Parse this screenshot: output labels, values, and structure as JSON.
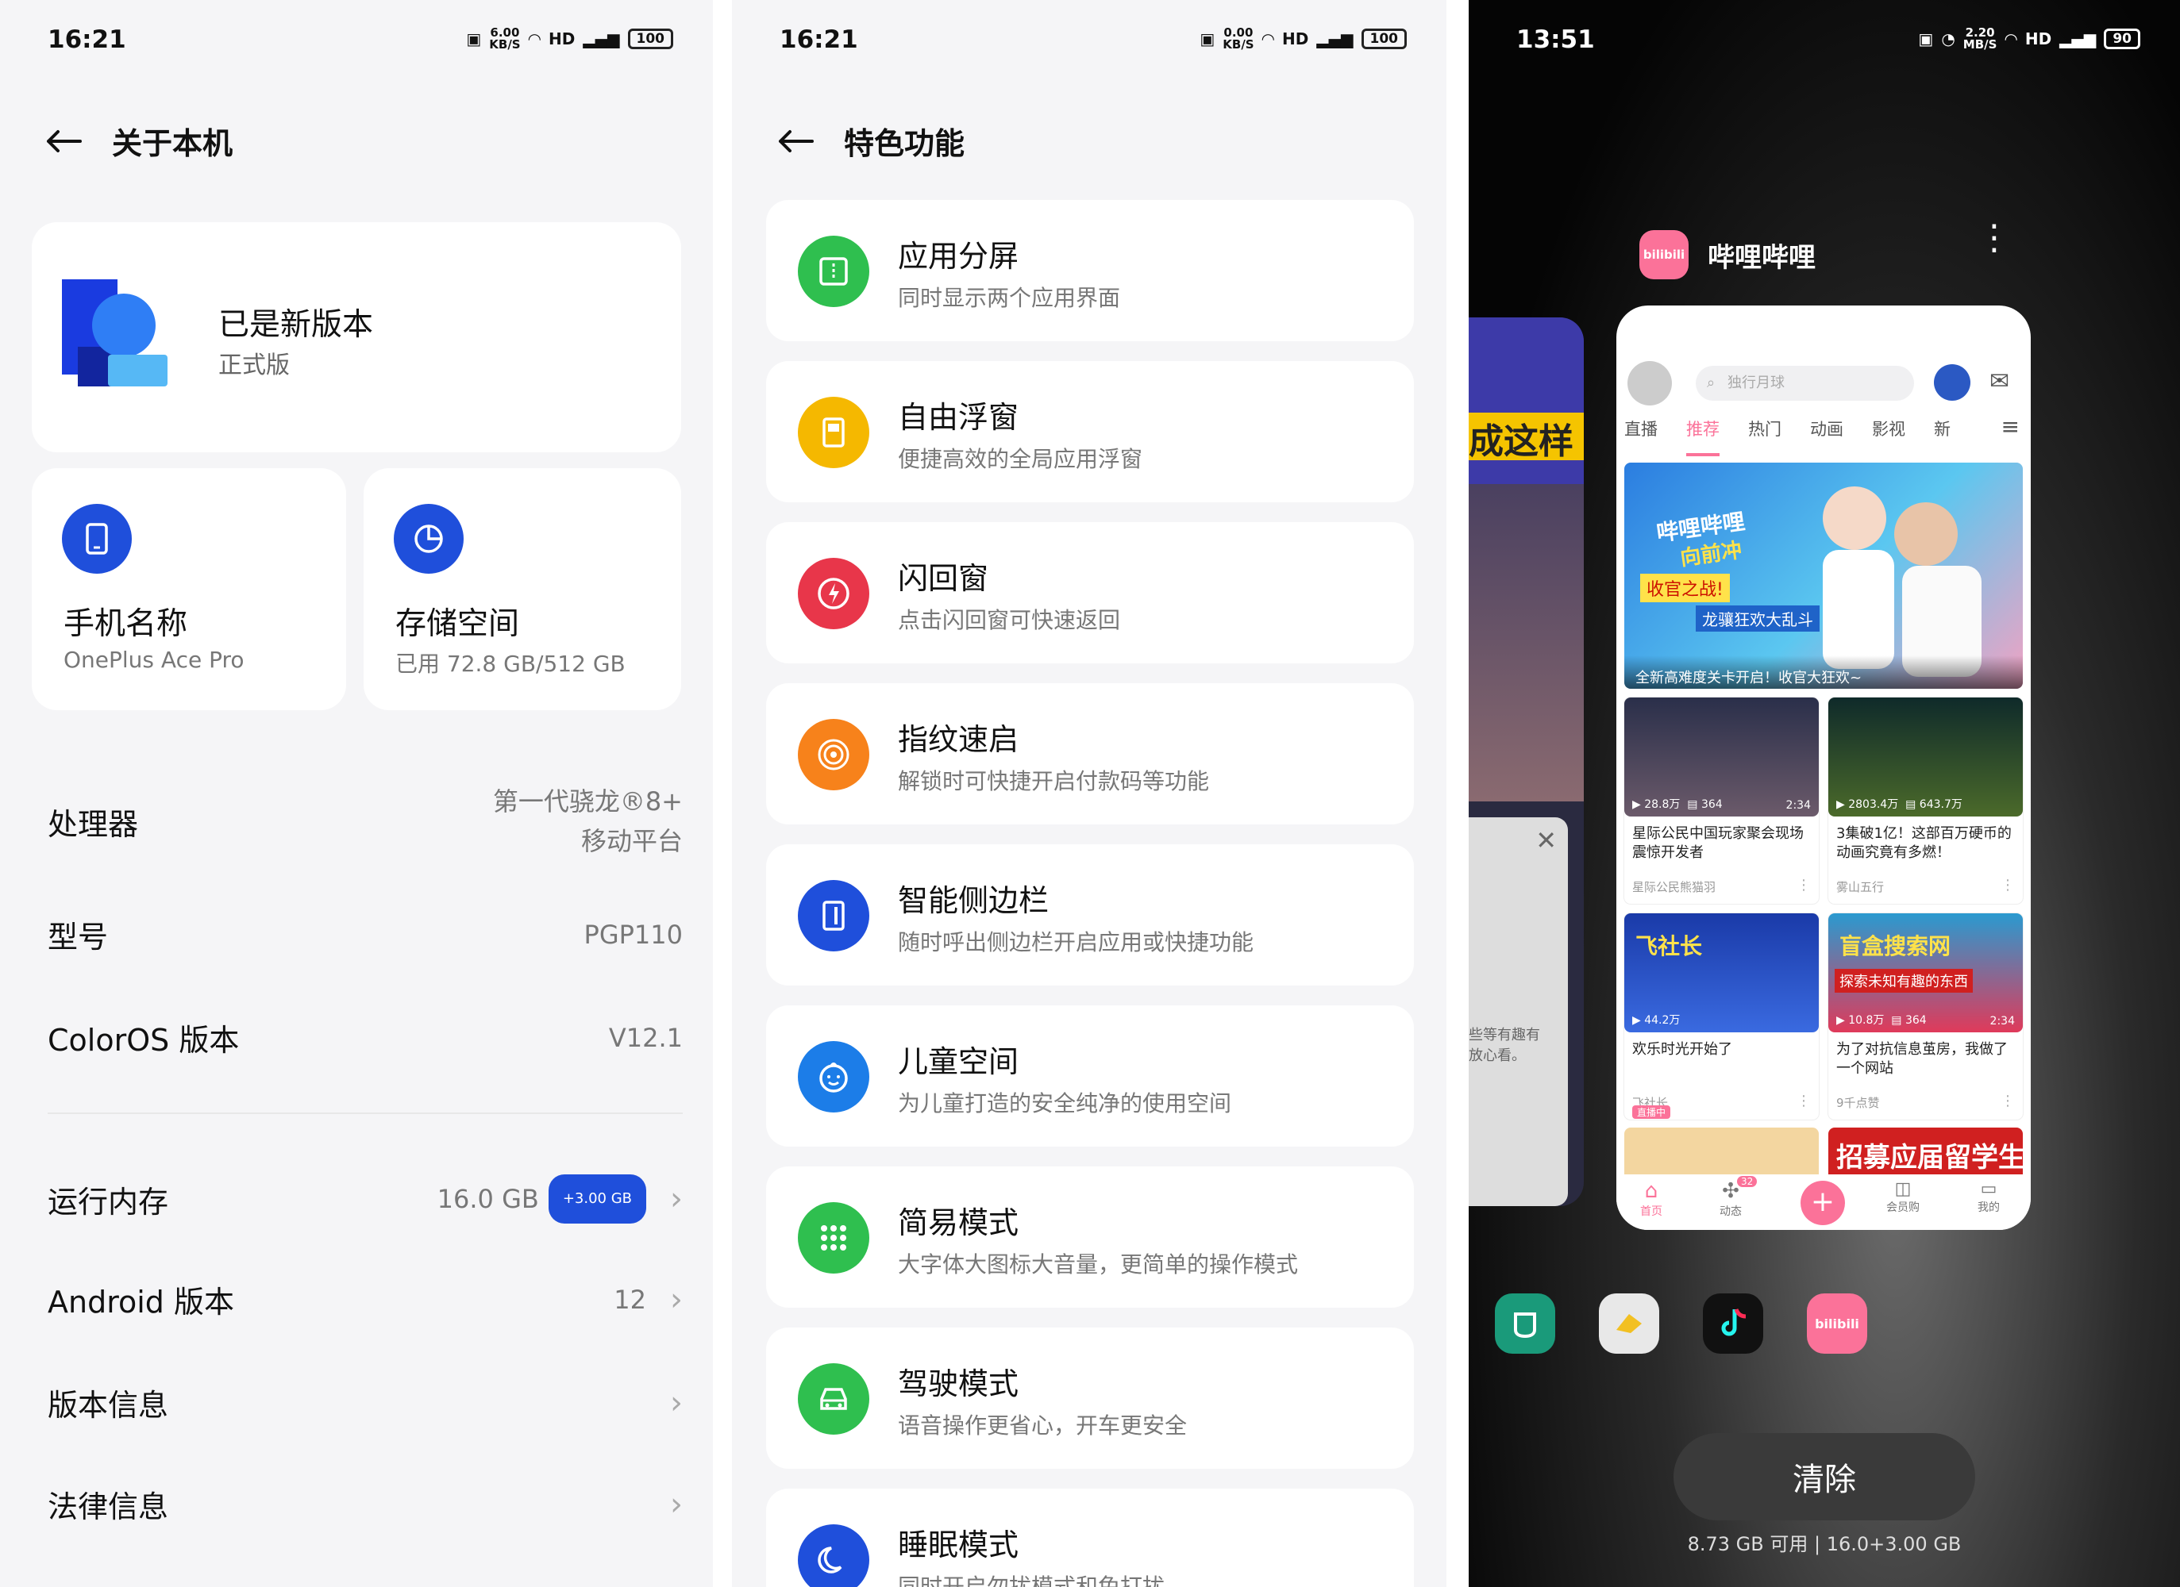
{
  "screen1": {
    "time": "16:21",
    "net_speed": "6.00",
    "net_unit": "KB/S",
    "battery": "100",
    "title": "关于本机",
    "version": {
      "title": "已是新版本",
      "subtitle": "正式版"
    },
    "phone_name": {
      "label": "手机名称",
      "value": "OnePlus Ace Pro"
    },
    "storage": {
      "label": "存储空间",
      "value": "已用 72.8 GB/512 GB"
    },
    "rows": [
      {
        "label": "处理器",
        "value": "第一代骁龙®8+",
        "value2": "移动平台"
      },
      {
        "label": "型号",
        "value": "PGP110"
      },
      {
        "label": "ColorOS 版本",
        "value": "V12.1"
      }
    ],
    "ram": {
      "label": "运行内存",
      "value": "16.0 GB",
      "badge": "+3.00 GB"
    },
    "android": {
      "label": "Android 版本",
      "value": "12"
    },
    "version_info": {
      "label": "版本信息"
    },
    "legal": {
      "label": "法律信息"
    }
  },
  "screen2": {
    "time": "16:21",
    "net_speed": "0.00",
    "net_unit": "KB/S",
    "battery": "100",
    "title": "特色功能",
    "features": [
      {
        "title": "应用分屏",
        "subtitle": "同时显示两个应用界面",
        "color": "#2fbf4f",
        "icon": "split-screen-icon"
      },
      {
        "title": "自由浮窗",
        "subtitle": "便捷高效的全局应用浮窗",
        "color": "#f5b800",
        "icon": "floating-window-icon"
      },
      {
        "title": "闪回窗",
        "subtitle": "点击闪回窗可快速返回",
        "color": "#e8364a",
        "icon": "flash-icon"
      },
      {
        "title": "指纹速启",
        "subtitle": "解锁时可快捷开启付款码等功能",
        "color": "#f7821b",
        "icon": "fingerprint-icon"
      },
      {
        "title": "智能侧边栏",
        "subtitle": "随时呼出侧边栏开启应用或快捷功能",
        "color": "#1f4fdb",
        "icon": "sidebar-icon"
      },
      {
        "title": "儿童空间",
        "subtitle": "为儿童打造的安全纯净的使用空间",
        "color": "#1c7de8",
        "icon": "child-face-icon"
      },
      {
        "title": "简易模式",
        "subtitle": "大字体大图标大音量，更简单的操作模式",
        "color": "#2fbf4f",
        "icon": "grid-dots-icon"
      },
      {
        "title": "驾驶模式",
        "subtitle": "语音操作更省心，开车更安全",
        "color": "#2fbf4f",
        "icon": "car-icon"
      },
      {
        "title": "睡眠模式",
        "subtitle": "同时开启勿扰模式和免打扰",
        "color": "#1f4fdb",
        "icon": "moon-icon"
      }
    ]
  },
  "screen3": {
    "time": "13:51",
    "net_speed": "2.20",
    "net_unit": "MB/S",
    "battery": "90",
    "app_name": "哔哩哔哩",
    "bili_logo_text": "bilibili",
    "search_placeholder": "独行月球",
    "tabs": [
      "直播",
      "推荐",
      "热门",
      "动画",
      "影视",
      "新"
    ],
    "banner_caption": "全新高难度关卡开启！收官大狂欢~",
    "banner_texts": [
      "哔哩哔哩",
      "向前冲",
      "收官之战!",
      "龙骧狂欢大乱斗"
    ],
    "videos": [
      {
        "views": "28.8万",
        "comments": "364",
        "duration": "2:34",
        "title": "星际公民中国玩家聚会现场震惊开发者",
        "up": "星际公民熊猫羽"
      },
      {
        "views": "2803.4万",
        "comments": "643.7万",
        "duration": "",
        "title": "3集破1亿！这部百万硬币的动画究竟有多燃！",
        "up": "雾山五行"
      },
      {
        "views": "44.2万",
        "comments": "",
        "duration": "",
        "title": "欢乐时光开始了",
        "up": "飞社长",
        "badge": "直播中",
        "thumb_text": "飞社长"
      },
      {
        "views": "10.8万",
        "comments": "364",
        "duration": "2:34",
        "title": "为了对抗信息茧房，我做了一个网站",
        "up": "9千点赞",
        "thumb_text": "盲盒搜索网",
        "thumb_text2": "探索未知有趣的东西"
      }
    ],
    "ad_text": "招募应届留学生",
    "bottom_nav": [
      "首页",
      "动态",
      "会员购",
      "我的"
    ],
    "nav_badge": "32",
    "clear_label": "清除",
    "memory": "8.73 GB 可用 | 16.0+3.00 GB",
    "left_card_text": "成这样",
    "left_card_text2": "些等有趣有",
    "left_card_text3": "放心看。"
  }
}
